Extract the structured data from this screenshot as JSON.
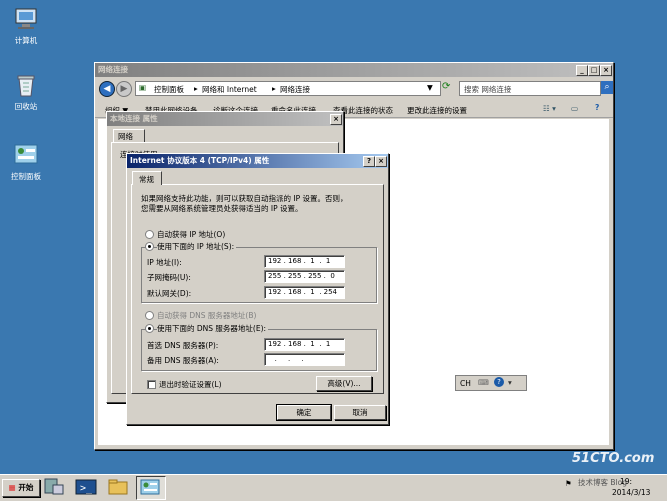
{
  "desktop": {
    "icons": [
      {
        "label": "计算机",
        "icon": "computer-icon"
      },
      {
        "label": "回收站",
        "icon": "recycle-bin-icon"
      },
      {
        "label": "控制面板",
        "icon": "control-panel-icon"
      }
    ]
  },
  "explorer": {
    "title": "网络连接",
    "breadcrumb": [
      "控制面板",
      "网络和 Internet",
      "网络连接"
    ],
    "search_placeholder": "搜索 网络连接",
    "toolbar": {
      "organize": "组织 ▼",
      "item1": "禁用此网络设备",
      "item2": "诊断这个连接",
      "item3": "重命名此连接",
      "item4": "查看此连接的状态",
      "item5": "更改此连接的设置"
    }
  },
  "conn_props": {
    "title": "本地连接 属性",
    "tab": "网络",
    "label": "连接时使用:"
  },
  "ipv4": {
    "title": "Internet 协议版本 4 (TCP/IPv4) 属性",
    "tab": "常规",
    "desc_line1": "如果网络支持此功能，则可以获取自动指派的 IP 设置。否则，",
    "desc_line2": "您需要从网络系统管理员处获得适当的 IP 设置。",
    "auto_ip": "自动获得 IP 地址(O)",
    "manual_ip": "使用下面的 IP 地址(S):",
    "ip_label": "IP 地址(I):",
    "ip_value": "192 . 168 .  1  .  1",
    "mask_label": "子网掩码(U):",
    "mask_value": "255 . 255 . 255 .  0",
    "gw_label": "默认网关(D):",
    "gw_value": "192 . 168 .  1  . 254",
    "auto_dns": "自动获得 DNS 服务器地址(B)",
    "manual_dns": "使用下面的 DNS 服务器地址(E):",
    "dns1_label": "首选 DNS 服务器(P):",
    "dns1_value": "192 . 168 .  1  .  1",
    "dns2_label": "备用 DNS 服务器(A):",
    "dns2_value": "   .     .     .   ",
    "validate": "退出时验证设置(L)",
    "advanced": "高级(V)...",
    "ok": "确定",
    "cancel": "取消",
    "help_btn": "?",
    "close_btn": "×"
  },
  "taskbar": {
    "start": "开始",
    "lang": "CH",
    "time": "19:",
    "date": "2014/3/13",
    "tray_text": "技术博客 Blog"
  },
  "watermark": {
    "site": "51CTO.com"
  },
  "colors": {
    "desktop": "#3a78b0",
    "active_title": "#0a246a",
    "face": "#d4d0c8"
  }
}
